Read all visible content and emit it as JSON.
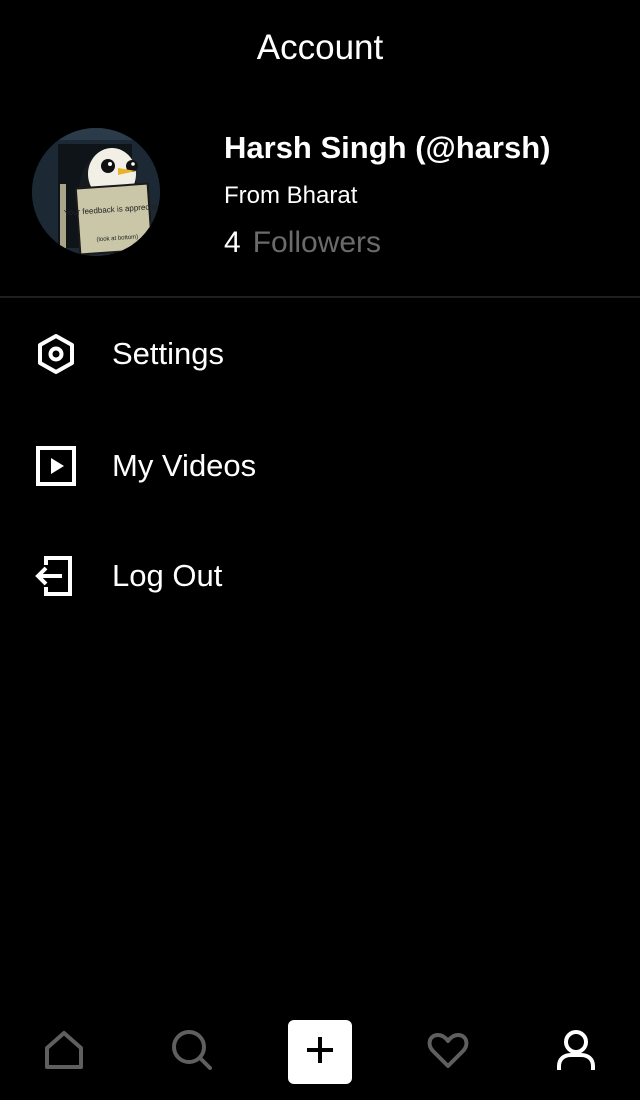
{
  "header": {
    "title": "Account"
  },
  "profile": {
    "avatar_sign_text": "Your feedback is appreciated",
    "avatar_sign_subtext": "(look at bottom)",
    "name": "Harsh Singh (@harsh)",
    "location": "From Bharat",
    "followers_count": "4",
    "followers_label": "Followers"
  },
  "menu": {
    "items": [
      {
        "label": "Settings",
        "icon": "settings-icon"
      },
      {
        "label": "My Videos",
        "icon": "video-icon"
      },
      {
        "label": "Log Out",
        "icon": "logout-icon"
      }
    ]
  },
  "bottom_nav": {
    "items": [
      {
        "icon": "home-icon",
        "active": false
      },
      {
        "icon": "search-icon",
        "active": false
      },
      {
        "icon": "plus-icon",
        "active": false
      },
      {
        "icon": "heart-icon",
        "active": false
      },
      {
        "icon": "user-icon",
        "active": true
      }
    ]
  },
  "colors": {
    "background": "#000000",
    "text": "#ffffff",
    "muted_text": "#6b6b6b",
    "inactive_icon": "#5f5f5f",
    "divider": "#1f1f1f"
  }
}
